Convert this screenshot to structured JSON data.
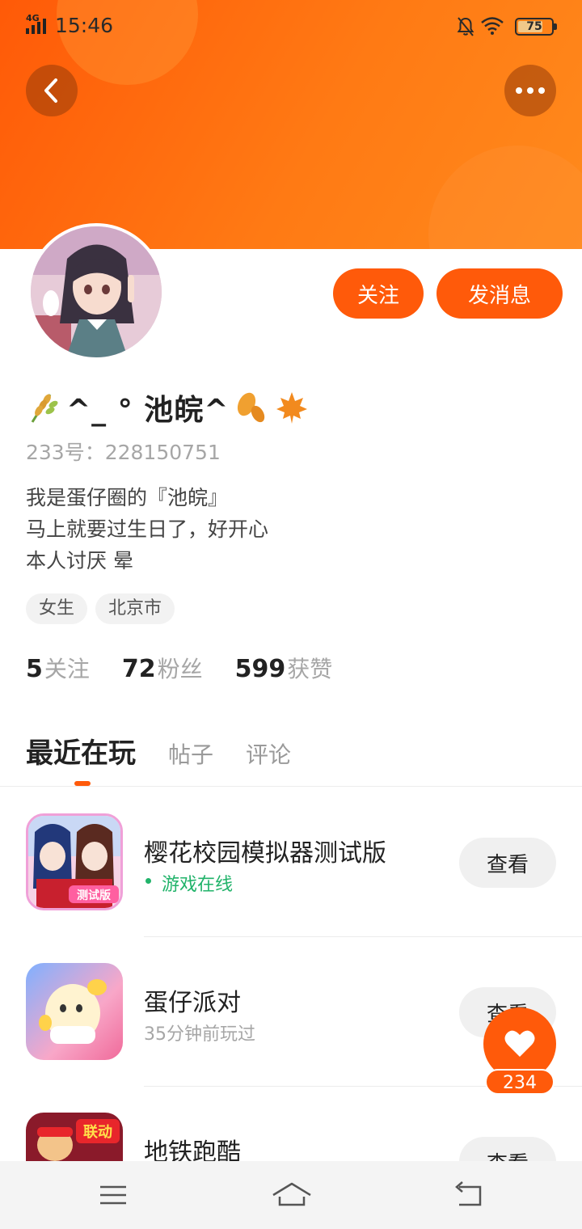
{
  "status_bar": {
    "network": "4G",
    "time": "15:46",
    "battery": "75"
  },
  "profile": {
    "nickname": "^_ ° 池皖^",
    "uid": "233号：228150751",
    "bio": [
      "我是蛋仔圈的『池皖』",
      "马上就要过生日了，好开心",
      "本人讨厌 晕"
    ],
    "tags": [
      "女生",
      "北京市"
    ],
    "stats": [
      {
        "num": "5",
        "label": "关注"
      },
      {
        "num": "72",
        "label": "粉丝"
      },
      {
        "num": "599",
        "label": "获赞"
      }
    ],
    "follow_label": "关注",
    "message_label": "发消息"
  },
  "tabs": [
    {
      "label": "最近在玩",
      "active": true
    },
    {
      "label": "帖子",
      "active": false
    },
    {
      "label": "评论",
      "active": false
    }
  ],
  "games": [
    {
      "name": "樱花校园模拟器测试版",
      "status": "游戏在线",
      "online": true,
      "button": "查看"
    },
    {
      "name": "蛋仔派对",
      "status": "35分钟前玩过",
      "online": false,
      "button": "查看"
    },
    {
      "name": "地铁跑酷",
      "status": "",
      "online": false,
      "button": "查看"
    }
  ],
  "game_icon_text": {
    "sakura": "测试版",
    "subway": "联动"
  },
  "like": {
    "count": "234"
  },
  "colors": {
    "accent": "#ff5a0a",
    "online": "#21b36a"
  },
  "icons": [
    "back-arrow-icon",
    "more-dots-icon",
    "heart-icon",
    "menu-icon",
    "home-icon",
    "return-icon"
  ]
}
